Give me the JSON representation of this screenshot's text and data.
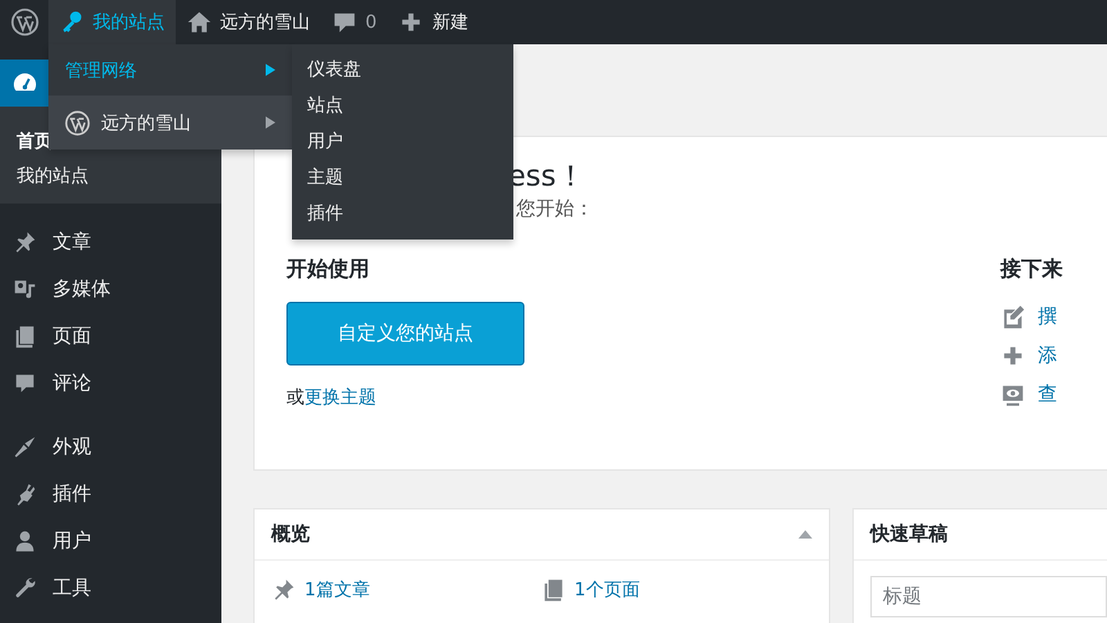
{
  "admin_bar": {
    "items": [
      {
        "kind": "my_sites",
        "label": "我的站点",
        "selected": true
      },
      {
        "kind": "site",
        "label": "远方的雪山",
        "selected": false
      },
      {
        "kind": "comments",
        "label": "0",
        "selected": false
      },
      {
        "kind": "new",
        "label": "新建",
        "selected": false
      }
    ]
  },
  "dropdown": {
    "items": [
      {
        "kind": "network",
        "label": "管理网络",
        "selected": true,
        "hovered": false
      },
      {
        "kind": "site",
        "label": "远方的雪山",
        "selected": false,
        "hovered": true
      }
    ]
  },
  "submenu": {
    "items": [
      "仪表盘",
      "站点",
      "用户",
      "主题",
      "插件"
    ]
  },
  "sidebar": {
    "dashboard": {
      "selected": true,
      "children": [
        {
          "label": "首页",
          "selected": true
        },
        {
          "label": "我的站点",
          "selected": false
        }
      ]
    },
    "groups": [
      [
        {
          "kind": "posts",
          "label": "文章",
          "selected": false
        },
        {
          "kind": "media",
          "label": "多媒体",
          "selected": false
        },
        {
          "kind": "pages",
          "label": "页面",
          "selected": false
        },
        {
          "kind": "comments",
          "label": "评论",
          "selected": false
        }
      ],
      [
        {
          "kind": "appearance",
          "label": "外观",
          "selected": false
        },
        {
          "kind": "plugins",
          "label": "插件",
          "selected": false
        },
        {
          "kind": "users",
          "label": "用户",
          "selected": false
        },
        {
          "kind": "tools",
          "label": "工具",
          "selected": false
        }
      ]
    ]
  },
  "welcome": {
    "title": "ess！",
    "subtitle": "您开始：",
    "start": {
      "heading": "开始使用",
      "button": "自定义您的站点",
      "or": "或",
      "link": "更换主题"
    },
    "next": {
      "heading": "接下来",
      "links": [
        {
          "kind": "write",
          "label": "撰"
        },
        {
          "kind": "add",
          "label": "添"
        },
        {
          "kind": "view",
          "label": "查"
        }
      ]
    }
  },
  "overview": {
    "title": "概览",
    "expanded": true,
    "items": [
      {
        "kind": "posts",
        "label": "1篇文章"
      },
      {
        "kind": "pages",
        "label": "1个页面"
      }
    ]
  },
  "quick_draft": {
    "title": "快速草稿",
    "title_field": {
      "placeholder": "标题"
    }
  }
}
